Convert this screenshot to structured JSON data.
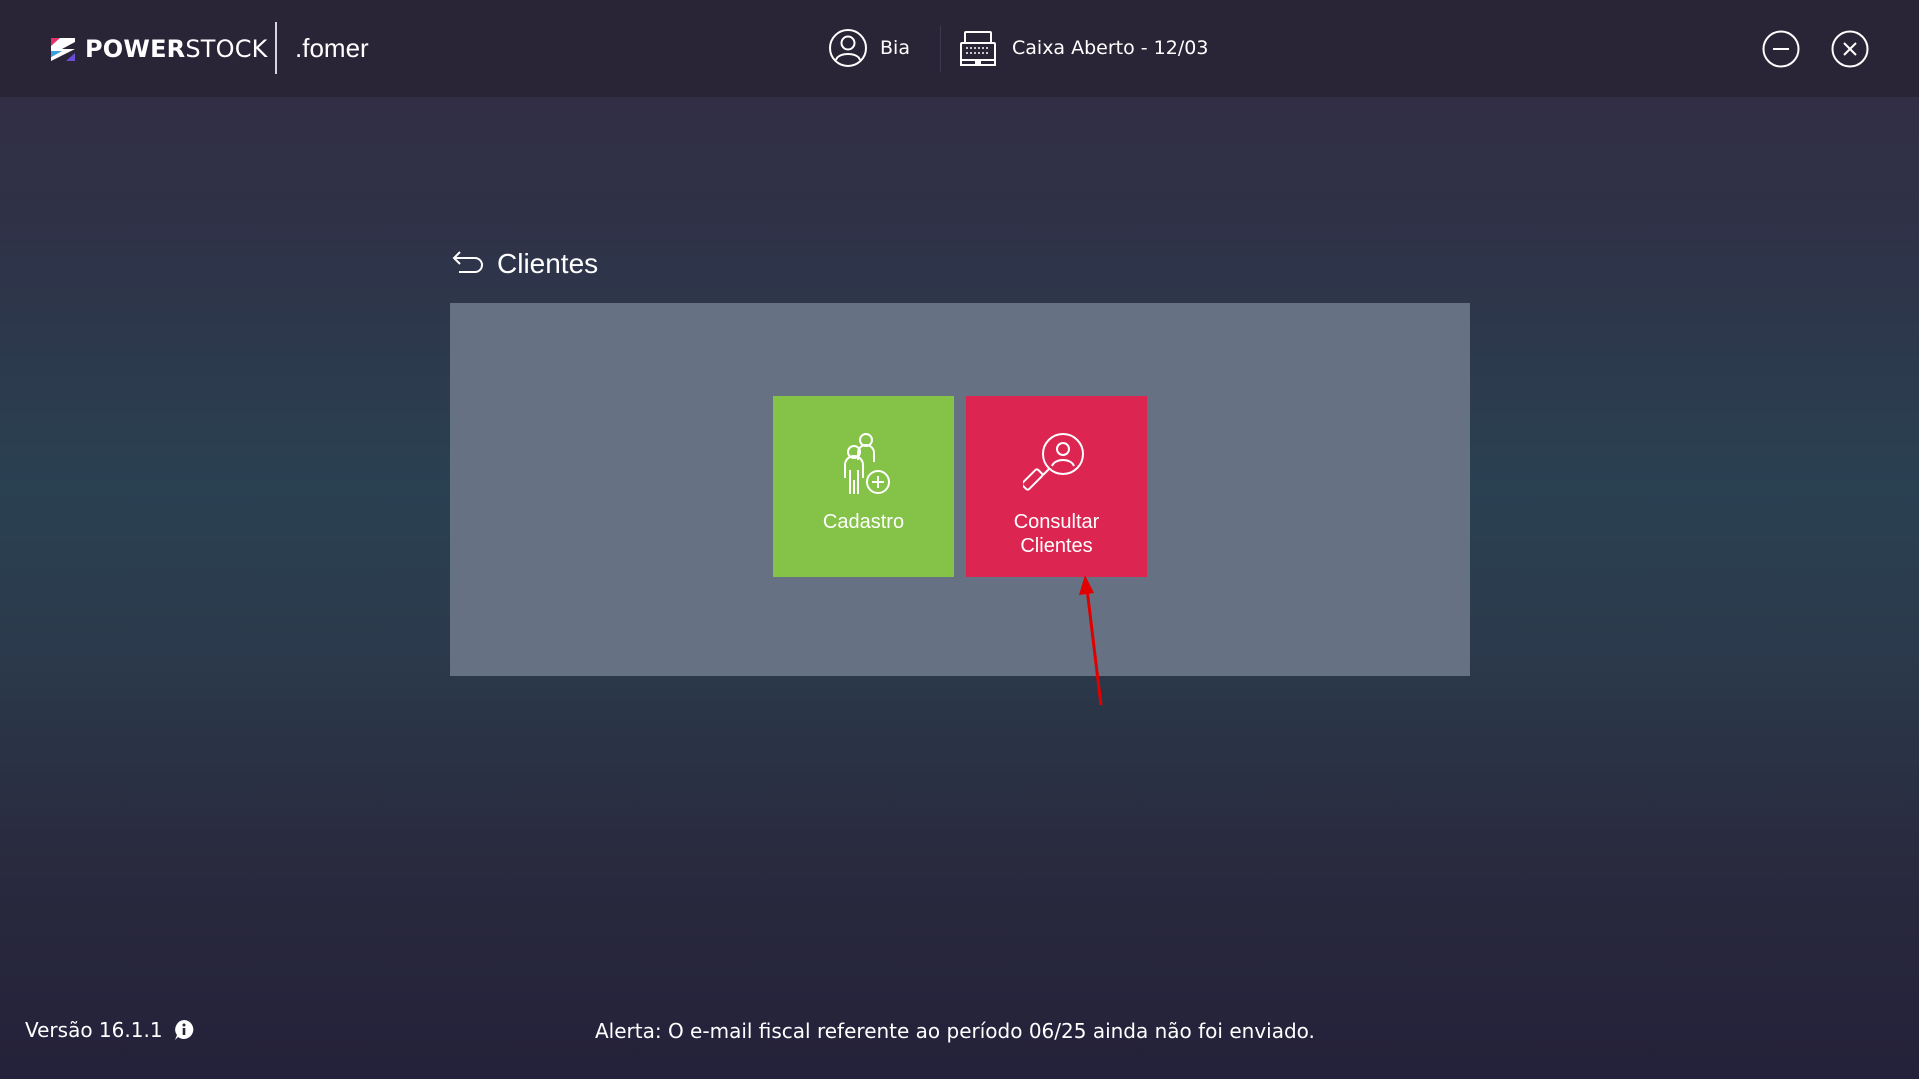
{
  "header": {
    "brand_bold": "POWER",
    "brand_light": "STOCK",
    "company": ".fomer",
    "user_name": "Bia",
    "caixa_status": "Caixa Aberto - 12/03",
    "icons": {
      "logo": "powerstock-logo-icon",
      "user": "user-circle-icon",
      "caixa": "cash-register-icon",
      "minimize": "minimize-circle-icon",
      "close": "close-circle-icon"
    }
  },
  "page": {
    "title": "Clientes",
    "back_icon": "back-arrow-icon"
  },
  "tiles": [
    {
      "label": "Cadastro",
      "icon": "add-person-icon",
      "color": "#84c248"
    },
    {
      "label": "Consultar\nClientes",
      "icon": "search-person-icon",
      "color": "#dc2551"
    }
  ],
  "annotation": {
    "color": "#e00000"
  },
  "footer": {
    "version": "Versão 16.1.1",
    "info_icon": "info-icon",
    "alert": "Alerta: O e-mail fiscal referente ao período 06/25 ainda não foi enviado."
  },
  "colors": {
    "topbar": "#2a2536",
    "panel": "#677184"
  }
}
